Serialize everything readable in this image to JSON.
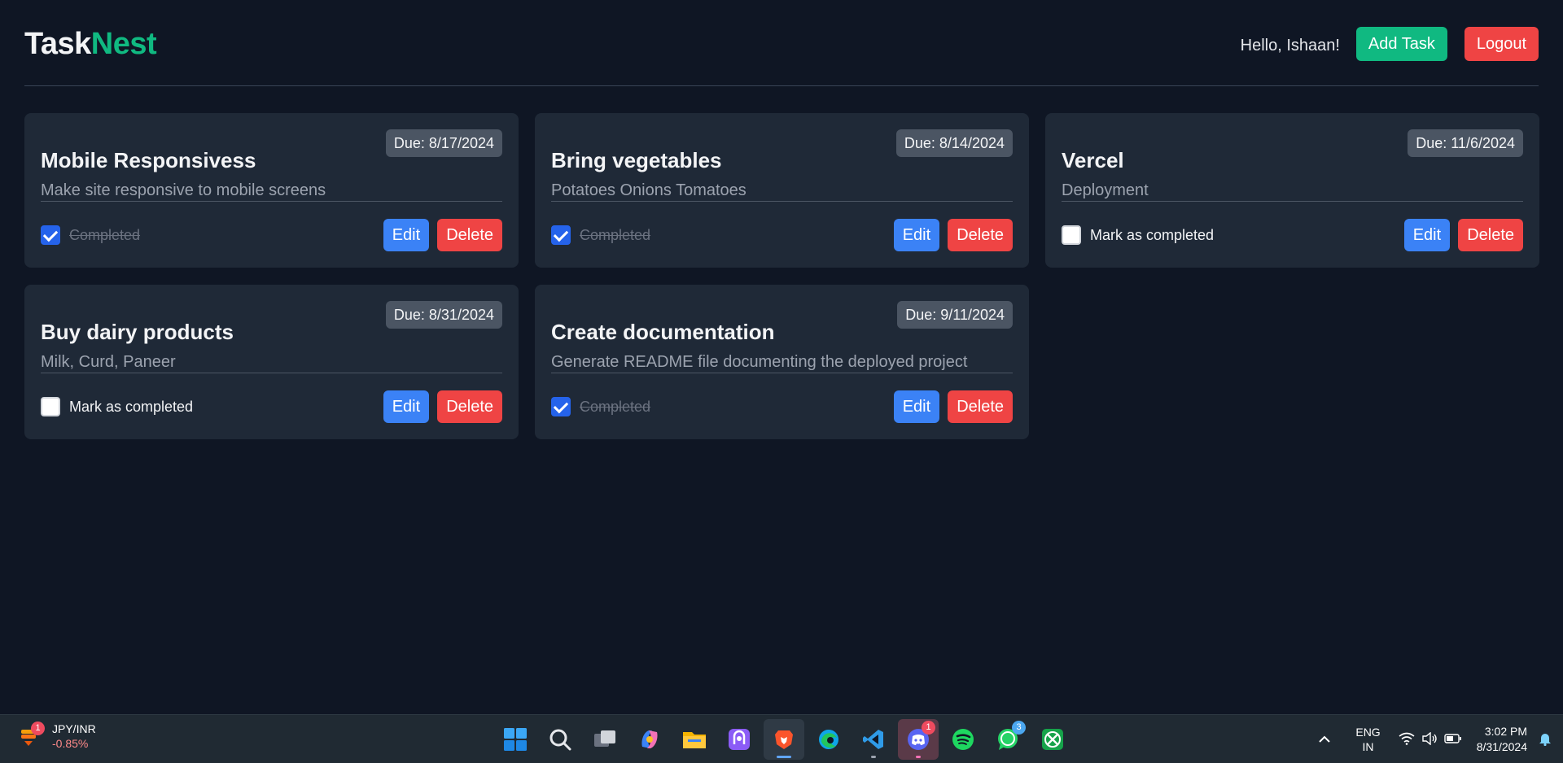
{
  "app": {
    "logo_part1": "Task",
    "logo_part2": "Nest",
    "greeting": "Hello, Ishaan!",
    "add_task_label": "Add Task",
    "logout_label": "Logout",
    "colors": {
      "accent": "#10b981",
      "danger": "#ef4444",
      "primary": "#3b82f6",
      "background": "#0f1624",
      "card": "#1f2937"
    }
  },
  "tasks": [
    {
      "title": "Mobile Responsivess",
      "due": "Due: 8/17/2024",
      "description": "Make site responsive to mobile screens",
      "completed": true,
      "status_label": "Completed",
      "edit_label": "Edit",
      "delete_label": "Delete"
    },
    {
      "title": "Bring vegetables",
      "due": "Due: 8/14/2024",
      "description": "Potatoes Onions Tomatoes",
      "completed": true,
      "status_label": "Completed",
      "edit_label": "Edit",
      "delete_label": "Delete"
    },
    {
      "title": "Vercel",
      "due": "Due: 11/6/2024",
      "description": "Deployment",
      "completed": false,
      "status_label": "Mark as completed",
      "edit_label": "Edit",
      "delete_label": "Delete"
    },
    {
      "title": "Buy dairy products",
      "due": "Due: 8/31/2024",
      "description": "Milk, Curd, Paneer",
      "completed": false,
      "status_label": "Mark as completed",
      "edit_label": "Edit",
      "delete_label": "Delete"
    },
    {
      "title": "Create documentation",
      "due": "Due: 9/11/2024",
      "description": "Generate README file documenting the deployed project",
      "completed": true,
      "status_label": "Completed",
      "edit_label": "Edit",
      "delete_label": "Delete"
    }
  ],
  "taskbar": {
    "widget": {
      "title": "JPY/INR",
      "change": "-0.85%",
      "badge": "1",
      "icon": "currency-widget-icon"
    },
    "pinned": [
      {
        "name": "windows-start-icon"
      },
      {
        "name": "search-icon"
      },
      {
        "name": "task-view-icon"
      },
      {
        "name": "copilot-icon"
      },
      {
        "name": "file-explorer-icon"
      },
      {
        "name": "proton-vpn-icon"
      },
      {
        "name": "brave-browser-icon",
        "active": true
      },
      {
        "name": "edge-browser-icon"
      },
      {
        "name": "vscode-icon"
      },
      {
        "name": "discord-icon",
        "active": true,
        "badge": "1"
      },
      {
        "name": "spotify-icon"
      },
      {
        "name": "whatsapp-icon",
        "badge": "3"
      },
      {
        "name": "xbox-icon"
      }
    ],
    "lang_top": "ENG",
    "lang_bottom": "IN",
    "time": "3:02 PM",
    "date": "8/31/2024"
  }
}
